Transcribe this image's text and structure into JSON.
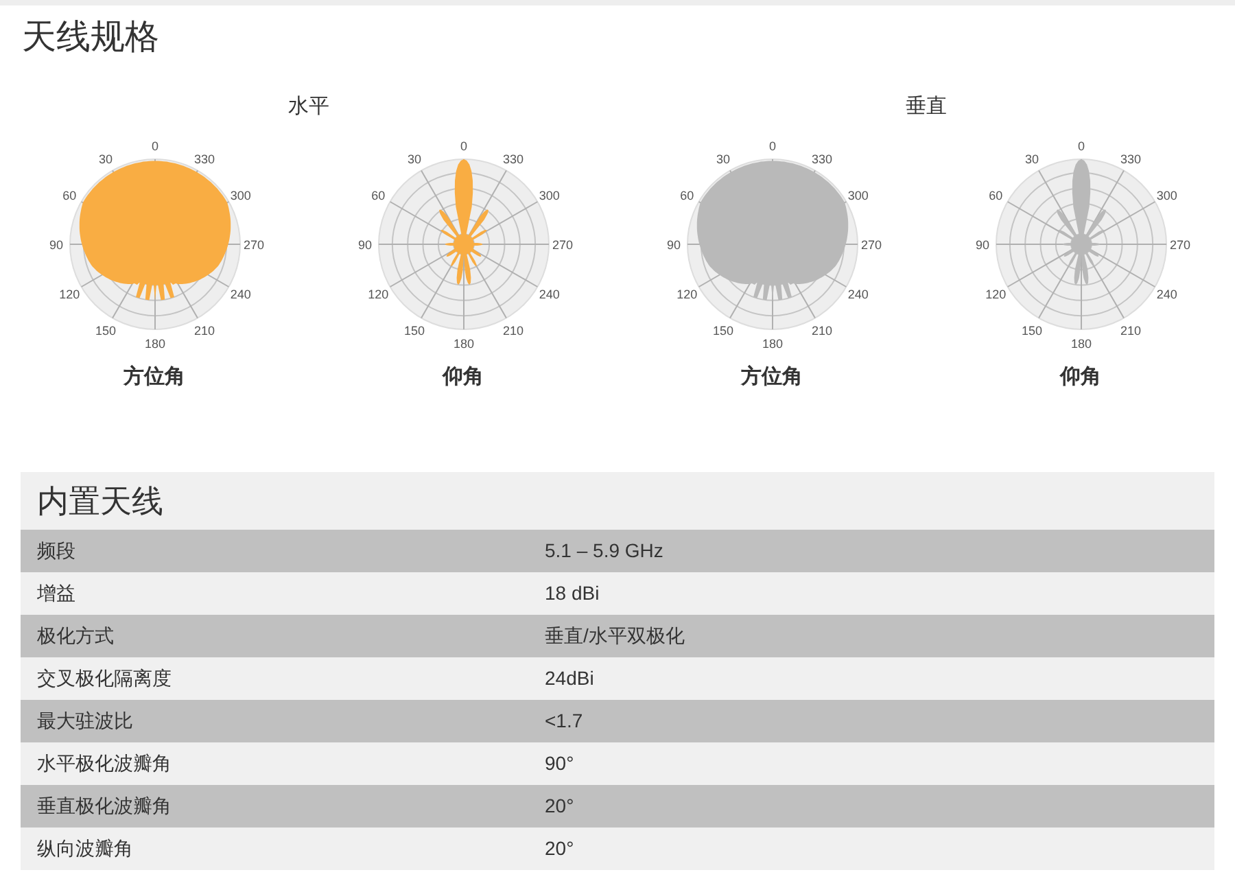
{
  "title": "天线规格",
  "pattern_groups": [
    {
      "title": "水平",
      "charts": [
        {
          "kind": "azimuth",
          "color": "#f9ad43",
          "caption": "方位角",
          "angle_labels": [
            "0",
            "30",
            "60",
            "90",
            "120",
            "150",
            "180",
            "210",
            "240",
            "270",
            "300",
            "330"
          ]
        },
        {
          "kind": "elevation",
          "color": "#f9ad43",
          "caption": "仰角",
          "angle_labels": [
            "0",
            "30",
            "60",
            "90",
            "120",
            "150",
            "180",
            "210",
            "240",
            "270",
            "300",
            "330"
          ]
        }
      ]
    },
    {
      "title": "垂直",
      "charts": [
        {
          "kind": "azimuth",
          "color": "#b9b9b9",
          "caption": "方位角",
          "angle_labels": [
            "0",
            "30",
            "60",
            "90",
            "120",
            "150",
            "180",
            "210",
            "240",
            "270",
            "300",
            "330"
          ]
        },
        {
          "kind": "elevation",
          "color": "#b9b9b9",
          "caption": "仰角",
          "angle_labels": [
            "0",
            "30",
            "60",
            "90",
            "120",
            "150",
            "180",
            "210",
            "240",
            "270",
            "300",
            "330"
          ]
        }
      ]
    }
  ],
  "spec_table": {
    "title": "内置天线",
    "rows": [
      {
        "label": "频段",
        "value": "5.1 – 5.9 GHz"
      },
      {
        "label": "增益",
        "value": "18 dBi"
      },
      {
        "label": "极化方式",
        "value": "垂直/水平双极化"
      },
      {
        "label": "交叉极化隔离度",
        "value": "24dBi"
      },
      {
        "label": "最大驻波比",
        "value": "<1.7"
      },
      {
        "label": "水平极化波瓣角",
        "value": "90°"
      },
      {
        "label": "垂直极化波瓣角",
        "value": "20°"
      },
      {
        "label": "纵向波瓣角",
        "value": "20°"
      }
    ]
  }
}
